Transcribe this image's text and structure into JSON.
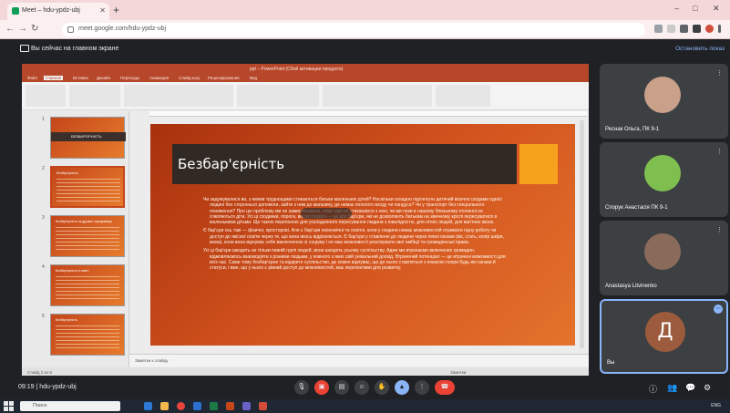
{
  "browser": {
    "tab_title": "Meet – hdu-ypdz-ubj",
    "url": "meet.google.com/hdu-ypdz-ubj",
    "new_tab": "+",
    "minimize": "–",
    "maximize": "□",
    "close": "✕"
  },
  "presenting": {
    "message": "Вы сейчас на главном экране",
    "stop_label": "Остановить показ"
  },
  "powerpoint": {
    "window_title": "ppt – PowerPoint (Сбой активации продукта)",
    "tabs": [
      "Файл",
      "Главная",
      "Вставка",
      "Дизайн",
      "Переходы",
      "Анимация",
      "Слайд-шоу",
      "Рецензирование",
      "Вид"
    ],
    "notes_placeholder": "Заметки к слайду",
    "status_left": "Слайд 2 из 6",
    "status_right": "Заметки"
  },
  "thumbnails": [
    {
      "num": "1",
      "title": "БЕЗБАР'ЄРНІСТЬ"
    },
    {
      "num": "2",
      "title": "Безбар'єрність"
    },
    {
      "num": "3",
      "title": "Безбар'єрність як дружнє середовище"
    },
    {
      "num": "4",
      "title": "Безбар'єрність в освіті"
    },
    {
      "num": "5",
      "title": "Безбар'єрність"
    }
  ],
  "slide": {
    "title": "Безбар'єрність",
    "bullets": [
      "Чи задумувалися ви, з якими труднощами стикаються батьки маленьких дітей? Наскільки складно підтягнути дитячий візочок сходами однієї людині без сторонньої допомоги, зайти з ним до магазину, де немає пологого входу чи пандуса? Чи у транспорт без спеціального пониження? Про цю проблему ми не замислюємося, поки самі не стикаємося з нею, чи ми поки в нашому близькому оточенні не з'являються діти. Усі ці сходинки, пороги, високі пороги — це все бар'єри, які не дозволяють батькам на звичному кріслі пересуватися в маленькими дітьми. Ще такою перепоною для ускладненого пересування людини з інвалідністю, для літніх людей, для вагітних жінок.",
      "Є бар'єри ось такі — фізичні, просторові. Але є бар'єри економічні та освітні, коли у людини немає можливостей отримати гідну роботу чи доступ до якісної освіти через те, що вона якось відрізняється. Є бар'єри у ставленні до людини через певні ознаки (вік, стать, колір шкіри, мова), коли вона відчуває себе виключеною зі соціуму і не має можливості реалізувати свої амбіції та громадянські права.",
      "Усі ці бар'єри шкодять не тільки певній групі людей, вони шкодять усьому суспільству. Адже ми втрачаємо включених громадян, відмовляємось взаємодіяти з різними людьми, у кожного з яких свій унікальний досвід. Втрачений потенціал — це втрачені можливості для всіх нас. Саме тому безбар'єрне та відкрите суспільство, де кожен відчуває, що до нього ставляться з повагою попри будь-які ознаки й статуси, і вже, що у нього є рівний доступ до можливостей, має перспективи для розвитку."
    ]
  },
  "participants": [
    {
      "name": "Реснак Ольга, ПК 9-1",
      "avatar_color": "#c9a089"
    },
    {
      "name": "Спорук Анастасія ПК 9-1",
      "avatar_color": "#7fbf4f"
    },
    {
      "name": "Anastasya Litvinenko",
      "avatar_color": "#8a6a5a"
    },
    {
      "name": "Вы",
      "initial": "Д",
      "avatar_color": "#9c5b3c"
    }
  ],
  "meeting": {
    "time": "09:19",
    "code": "hdu-ypdz-ubj"
  },
  "taskbar": {
    "search_placeholder": "Поиск",
    "tray_text": "ENG"
  }
}
